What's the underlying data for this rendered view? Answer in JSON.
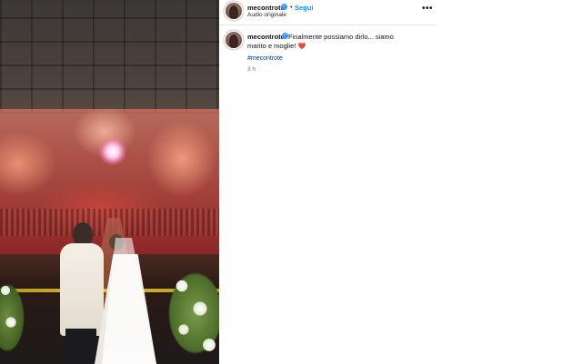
{
  "post": {
    "username": "mecontrote",
    "follow_separator": "•",
    "follow_label": "Segui",
    "audio_label": "Audio originale",
    "more_label": "•••"
  },
  "caption": {
    "username": "mecontrote",
    "text": "Finalmente possiamo dirlo... siamo marito e moglie!",
    "emoji": "❤️",
    "hashtag": "#mecontrote",
    "time": "3 h"
  },
  "colors": {
    "link": "#0095f6",
    "verified": "#3897f0",
    "hashtag": "#00376b"
  }
}
